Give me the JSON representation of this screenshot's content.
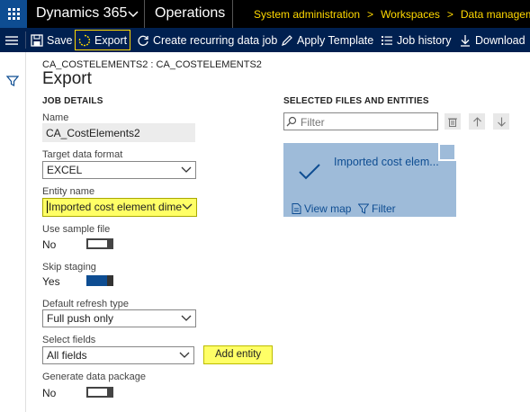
{
  "topbar": {
    "brand": "Dynamics 365",
    "module": "Operations",
    "breadcrumbs": [
      "System administration",
      "Workspaces",
      "Data management"
    ]
  },
  "actionbar": {
    "save": "Save",
    "export": "Export",
    "recurring": "Create recurring data job",
    "apply_template": "Apply Template",
    "job_history": "Job history",
    "download": "Download"
  },
  "page": {
    "caption": "CA_COSTELEMENTS2 : CA_COSTELEMENTS2",
    "title": "Export"
  },
  "job_details": {
    "heading": "JOB DETAILS",
    "name_label": "Name",
    "name_value": "CA_CostElements2",
    "format_label": "Target data format",
    "format_value": "EXCEL",
    "entity_label": "Entity name",
    "entity_value": "Imported cost element dimer",
    "sample_label": "Use sample file",
    "sample_value": "No",
    "staging_label": "Skip staging",
    "staging_value": "Yes",
    "refresh_label": "Default refresh type",
    "refresh_value": "Full push only",
    "fields_label": "Select fields",
    "fields_value": "All fields",
    "add_entity": "Add entity",
    "package_label": "Generate data package",
    "package_value": "No"
  },
  "selected": {
    "heading": "SELECTED FILES AND ENTITIES",
    "filter_placeholder": "Filter",
    "tile_name": "Imported cost elem...",
    "view_map": "View map",
    "filter_link": "Filter"
  },
  "colors": {
    "header_bg": "#000000",
    "action_bg": "#002050",
    "accent": "#0e4d92",
    "breadcrumb": "#ffd800",
    "highlight": "#ffff66",
    "tile_bg": "#9ebbd9"
  }
}
